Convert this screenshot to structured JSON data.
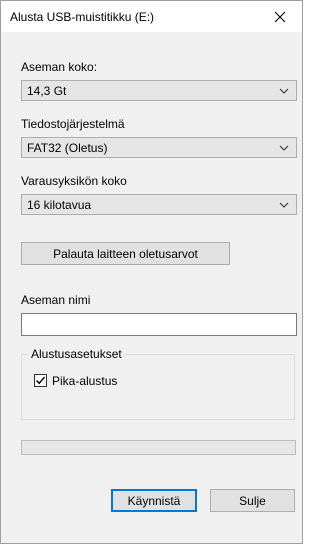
{
  "window": {
    "title": "Alusta USB-muistitikku (E:)"
  },
  "capacity": {
    "label": "Aseman koko:",
    "value": "14,3 Gt"
  },
  "filesystem": {
    "label": "Tiedostojärjestelmä",
    "value": "FAT32 (Oletus)"
  },
  "allocation": {
    "label": "Varausyksikön koko",
    "value": "16 kilotavua"
  },
  "restore_button": "Palauta laitteen oletusarvot",
  "volume_label": {
    "label": "Aseman nimi",
    "value": ""
  },
  "format_options": {
    "title": "Alustusasetukset",
    "quick_format": {
      "label": "Pika-alustus",
      "checked": true
    }
  },
  "progress": {
    "fraction": 0
  },
  "buttons": {
    "start": "Käynnistä",
    "close": "Sulje"
  }
}
